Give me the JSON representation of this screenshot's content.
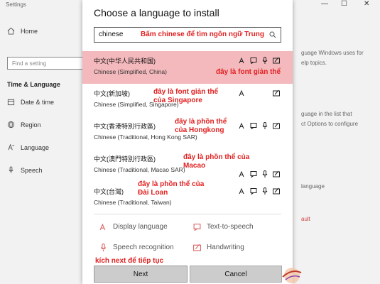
{
  "window": {
    "title": "Settings"
  },
  "sidebar": {
    "home": "Home",
    "search_placeholder": "Find a setting",
    "section": "Time & Language",
    "items": [
      {
        "label": "Date & time",
        "icon": "calendar-icon"
      },
      {
        "label": "Region",
        "icon": "globe-icon"
      },
      {
        "label": "Language",
        "icon": "language-icon"
      },
      {
        "label": "Speech",
        "icon": "microphone-icon"
      }
    ]
  },
  "background_right": {
    "line1": "guage Windows uses for",
    "line2": "elp topics.",
    "line3": "guage in the list that",
    "line4": "ct Options to configure",
    "line5": "language",
    "line6": "ault"
  },
  "dialog": {
    "title": "Choose a language to install",
    "search_value": "chinese",
    "search_annotation": "Bấm chinese để tìm ngôn ngữ Trung",
    "languages": [
      {
        "native": "中文(中华人民共和国)",
        "english": "Chinese (Simplified, China)",
        "annotation": "đây là font giản thể",
        "selected": true
      },
      {
        "native": "中文(新加坡)",
        "english": "Chinese (Simplified, Singapore)",
        "annotation": "đây là font giản thể của Singapore",
        "selected": false
      },
      {
        "native": "中文(香港特別行政區)",
        "english": "Chinese (Traditional, Hong Kong SAR)",
        "annotation": "đây là phồn thể của Hongkong",
        "selected": false
      },
      {
        "native": "中文(澳門特別行政區)",
        "english": "Chinese (Traditional, Macao SAR)",
        "annotation": "đây là phồn thể của Macao",
        "selected": false
      },
      {
        "native": "中文(台灣)",
        "english": "Chinese (Traditional, Taiwan)",
        "annotation": "đây là phồn thể của Đài Loan",
        "selected": false
      }
    ],
    "legend": {
      "display_language": "Display language",
      "text_to_speech": "Text-to-speech",
      "speech_recognition": "Speech recognition",
      "handwriting": "Handwriting"
    },
    "next_annotation": "kích next để tiếp tục",
    "next_label": "Next",
    "cancel_label": "Cancel"
  },
  "colors": {
    "selected_row": "#f4b9bd",
    "annotation": "#e02020"
  }
}
